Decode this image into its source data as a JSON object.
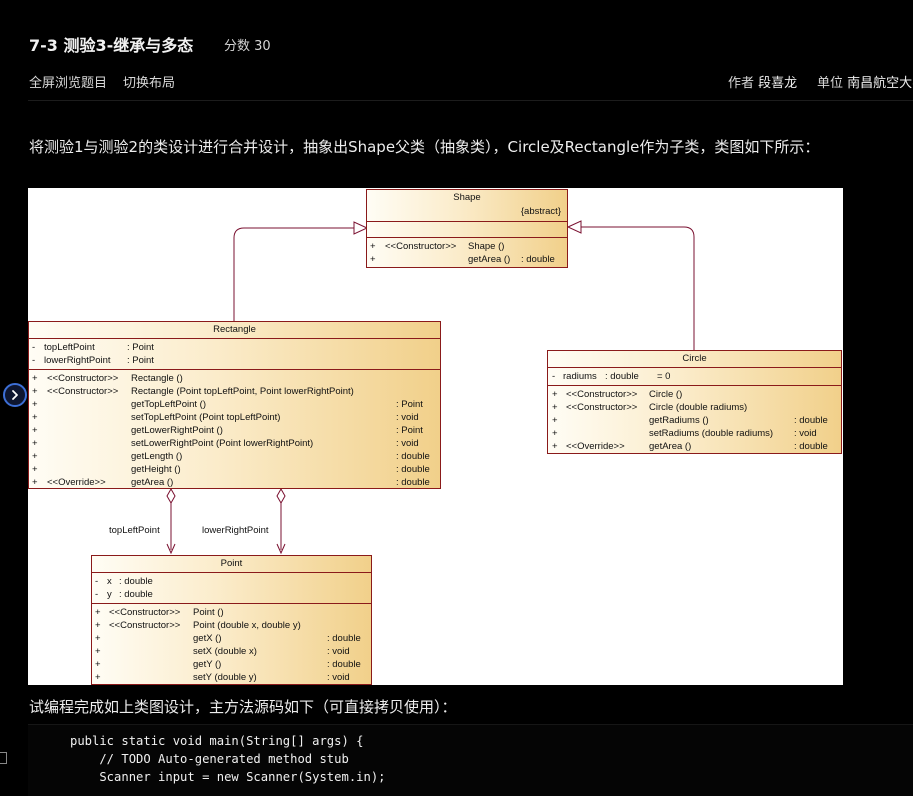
{
  "header": {
    "title": "7-3 测验3-继承与多态",
    "score": "分数 30",
    "fullscreen_label": "全屏浏览题目",
    "switch_layout_label": "切换布局",
    "author_label": "作者",
    "author_name": "段喜龙",
    "unit_label": "单位",
    "unit_name": "南昌航空大学"
  },
  "problem": {
    "description": "将测验1与测验2的类设计进行合并设计，抽象出Shape父类（抽象类），Circle及Rectangle作为子类，类图如下所示：",
    "instruction": "试编程完成如上类图设计，主方法源码如下（可直接拷贝使用）："
  },
  "diagram": {
    "shape": {
      "name": "Shape",
      "stereotype": "{abstract}",
      "methods": [
        {
          "vis": "+",
          "stereo": "<<Constructor>>",
          "name": "Shape ()",
          "type": ""
        },
        {
          "vis": "+",
          "stereo": "",
          "name": "getArea ()",
          "type": ": double"
        }
      ]
    },
    "rectangle": {
      "name": "Rectangle",
      "attributes": [
        {
          "vis": "-",
          "name": "topLeftPoint",
          "type": ": Point"
        },
        {
          "vis": "-",
          "name": "lowerRightPoint",
          "type": ": Point"
        }
      ],
      "methods": [
        {
          "vis": "+",
          "stereo": "<<Constructor>>",
          "name": "Rectangle ()",
          "type": ""
        },
        {
          "vis": "+",
          "stereo": "<<Constructor>>",
          "name": "Rectangle (Point topLeftPoint, Point lowerRightPoint)",
          "type": ""
        },
        {
          "vis": "+",
          "stereo": "",
          "name": "getTopLeftPoint ()",
          "type": ": Point"
        },
        {
          "vis": "+",
          "stereo": "",
          "name": "setTopLeftPoint (Point topLeftPoint)",
          "type": ": void"
        },
        {
          "vis": "+",
          "stereo": "",
          "name": "getLowerRightPoint ()",
          "type": ": Point"
        },
        {
          "vis": "+",
          "stereo": "",
          "name": "setLowerRightPoint (Point lowerRightPoint)",
          "type": ": void"
        },
        {
          "vis": "+",
          "stereo": "",
          "name": "getLength ()",
          "type": ": double"
        },
        {
          "vis": "+",
          "stereo": "",
          "name": "getHeight ()",
          "type": ": double"
        },
        {
          "vis": "+",
          "stereo": "<<Override>>",
          "name": "getArea ()",
          "type": ": double"
        }
      ]
    },
    "circle": {
      "name": "Circle",
      "attributes": [
        {
          "vis": "-",
          "name": "radiums",
          "type": ": double",
          "default": "= 0"
        }
      ],
      "methods": [
        {
          "vis": "+",
          "stereo": "<<Constructor>>",
          "name": "Circle ()",
          "type": ""
        },
        {
          "vis": "+",
          "stereo": "<<Constructor>>",
          "name": "Circle (double radiums)",
          "type": ""
        },
        {
          "vis": "+",
          "stereo": "",
          "name": "getRadiums ()",
          "type": ": double"
        },
        {
          "vis": "+",
          "stereo": "",
          "name": "setRadiums (double radiums)",
          "type": ": void"
        },
        {
          "vis": "+",
          "stereo": "<<Override>>",
          "name": "getArea ()",
          "type": ": double"
        }
      ]
    },
    "point": {
      "name": "Point",
      "attributes": [
        {
          "vis": "-",
          "name": "x",
          "type": ": double"
        },
        {
          "vis": "-",
          "name": "y",
          "type": ": double"
        }
      ],
      "methods": [
        {
          "vis": "+",
          "stereo": "<<Constructor>>",
          "name": "Point ()",
          "type": ""
        },
        {
          "vis": "+",
          "stereo": "<<Constructor>>",
          "name": "Point (double x, double y)",
          "type": ""
        },
        {
          "vis": "+",
          "stereo": "",
          "name": "getX ()",
          "type": ": double"
        },
        {
          "vis": "+",
          "stereo": "",
          "name": "setX (double x)",
          "type": ": void"
        },
        {
          "vis": "+",
          "stereo": "",
          "name": "getY ()",
          "type": ": double"
        },
        {
          "vis": "+",
          "stereo": "",
          "name": "setY (double y)",
          "type": ": void"
        }
      ]
    },
    "associations": {
      "top_left": "topLeftPoint",
      "lower_right": "lowerRightPoint"
    }
  },
  "code": {
    "lines": [
      "public static void main(String[] args) {",
      "    // TODO Auto-generated method stub",
      "    Scanner input = new Scanner(System.in);"
    ]
  },
  "icons": {
    "side_toggle": "chevron-right-icon",
    "panel_handle": "panel-handle-icon"
  },
  "colors": {
    "page_bg": "#000000",
    "uml_border": "#8a1a1a",
    "uml_fill": "#f1d08a",
    "accent": "#3d6fd6"
  }
}
